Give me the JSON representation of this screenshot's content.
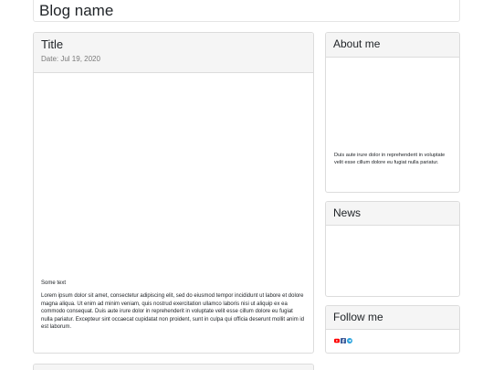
{
  "header": {
    "blog_name": "Blog name"
  },
  "post": {
    "title": "Title",
    "date": "Date: Jul 19, 2020",
    "subtext": "Some text",
    "paragraph": "Lorem ipsum dolor sit amet, consectetur adipiscing elit, sed do eiusmod tempor incididunt ut labore et dolore magna aliqua. Ut enim ad minim veniam, quis nostrud exercitation ullamco laboris nisi ut aliquip ex ea commodo consequat. Duis aute irure dolor in reprehenderit in voluptate velit esse cillum dolore eu fugiat nulla pariatur. Excepteur sint occaecat cupidatat non proident, sunt in culpa qui officia deserunt mollit anim id est laborum."
  },
  "sidebar": {
    "about": {
      "title": "About me",
      "text": "Duis aute irure dolor in reprehenderit in voluptate velit esse cillum dolore eu fugiat nulla pariatur."
    },
    "news": {
      "title": "News"
    },
    "follow": {
      "title": "Follow me",
      "icons": [
        "youtube-icon",
        "facebook-icon",
        "telegram-icon"
      ]
    }
  },
  "colors": {
    "youtube": "#ff0000",
    "facebook": "#3b5998",
    "telegram": "#2aa3de",
    "card_header_bg": "#f5f5f5",
    "border": "#dcdcdc"
  }
}
